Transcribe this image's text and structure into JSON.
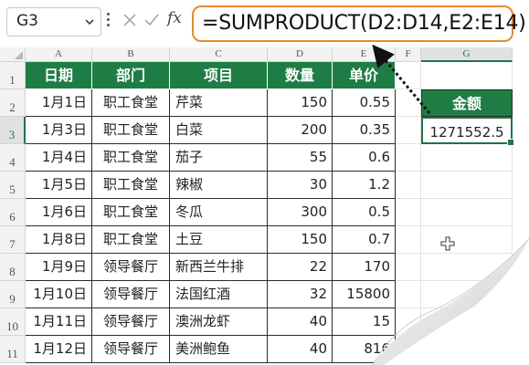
{
  "formula_bar": {
    "name_box": "G3",
    "formula": "=SUMPRODUCT(D2:D14,E2:E14)",
    "icons": [
      "chevron-down-icon",
      "more-vertical-icon",
      "cancel-icon",
      "confirm-icon",
      "function-icon"
    ],
    "fx_label": "fx"
  },
  "columns": [
    "A",
    "B",
    "C",
    "D",
    "E",
    "F",
    "G"
  ],
  "rows": [
    "1",
    "2",
    "3",
    "4",
    "5",
    "6",
    "7",
    "8",
    "9",
    "10",
    "11"
  ],
  "table": {
    "headers": [
      "日期",
      "部门",
      "项目",
      "数量",
      "单价"
    ],
    "rows": [
      [
        "1月1日",
        "职工食堂",
        "芹菜",
        "150",
        "0.55"
      ],
      [
        "1月3日",
        "职工食堂",
        "白菜",
        "200",
        "0.35"
      ],
      [
        "1月4日",
        "职工食堂",
        "茄子",
        "55",
        "0.6"
      ],
      [
        "1月5日",
        "职工食堂",
        "辣椒",
        "30",
        "1.2"
      ],
      [
        "1月6日",
        "职工食堂",
        "冬瓜",
        "300",
        "0.5"
      ],
      [
        "1月8日",
        "职工食堂",
        "土豆",
        "150",
        "0.7"
      ],
      [
        "1月9日",
        "领导餐厅",
        "新西兰牛排",
        "22",
        "170"
      ],
      [
        "1月10日",
        "领导餐厅",
        "法国红酒",
        "32",
        "15800"
      ],
      [
        "1月11日",
        "领导餐厅",
        "澳洲龙虾",
        "40",
        "15"
      ],
      [
        "1月12日",
        "领导餐厅",
        "美洲鲍鱼",
        "40",
        "816"
      ]
    ]
  },
  "result": {
    "label": "金额",
    "value": "1271552.5"
  },
  "colors": {
    "header_green": "#1e7d45",
    "highlight_orange": "#e38b2f",
    "selection_green": "#217346"
  }
}
